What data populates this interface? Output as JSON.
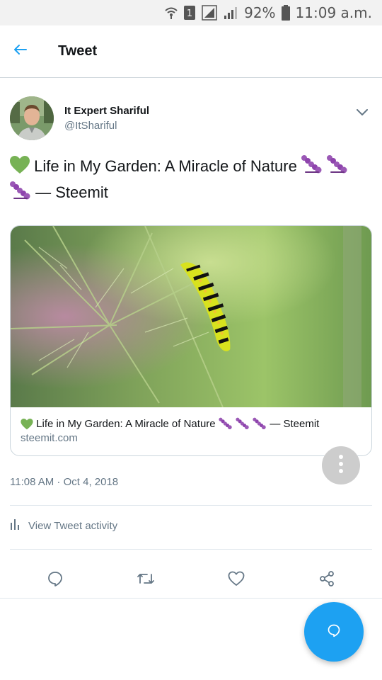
{
  "status_bar": {
    "battery": "92%",
    "time": "11:09 a.m.",
    "sim_slot": "1"
  },
  "header": {
    "title": "Tweet"
  },
  "tweet": {
    "author_name": "It Expert Shariful",
    "author_handle": "@ItShariful",
    "text_main": "Life in My Garden: A Miracle of Nature",
    "text_suffix": "— Steemit",
    "timestamp": "11:08 AM · Oct 4, 2018"
  },
  "card": {
    "title_main": "Life in My Garden: A Miracle of Nature",
    "title_suffix": "— Steemit",
    "domain": "steemit.com"
  },
  "activity": {
    "label": "View Tweet activity"
  },
  "icons": {
    "back": "back-arrow-icon",
    "caret": "chevron-down-icon",
    "heart_emoji": "green-heart-emoji",
    "caterpillar_emoji": "caterpillar-emoji",
    "reply": "reply-icon",
    "retweet": "retweet-icon",
    "like": "like-icon",
    "share": "share-icon",
    "more": "more-vertical-icon",
    "compose": "compose-icon",
    "activity": "bar-chart-icon"
  },
  "colors": {
    "accent": "#1da1f2",
    "secondary_text": "#657786",
    "green_heart": "#77b255",
    "caterpillar": "#9b59b6"
  }
}
